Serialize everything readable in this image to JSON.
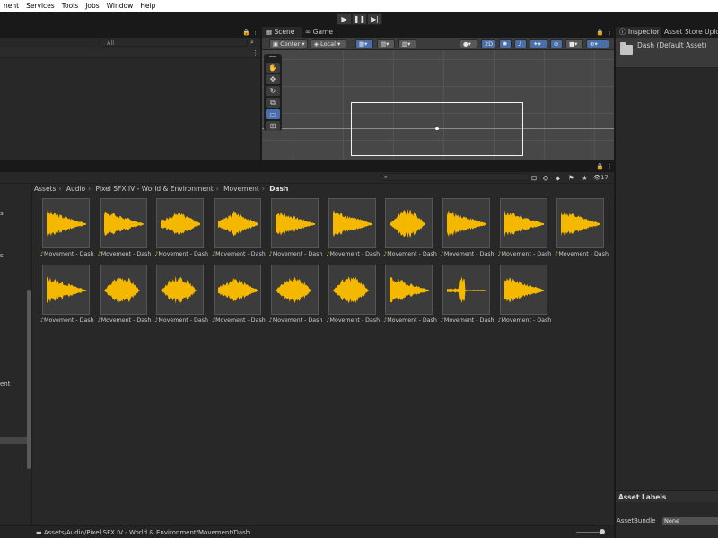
{
  "menu": [
    "nent",
    "Services",
    "Tools",
    "Jobs",
    "Window",
    "Help"
  ],
  "play_controls": {
    "play": "▶",
    "pause": "❚❚",
    "step": "▶|"
  },
  "hierarchy": {
    "search_placeholder": "All"
  },
  "scene": {
    "tab_scene": "Scene",
    "tab_game": "Game",
    "pivot": "Center",
    "space": "Local",
    "mode_2d": "2D"
  },
  "inspector": {
    "tab": "Inspector",
    "tab_store": "Asset Store Upload",
    "title": "Dash (Default Asset)",
    "labels_header": "Asset Labels",
    "assetbundle_label": "AssetBundle",
    "assetbundle_value": "None"
  },
  "project": {
    "hidden_count": "17",
    "breadcrumb": [
      "Assets",
      "Audio",
      "Pixel SFX IV - World & Environment",
      "Movement",
      "Dash"
    ],
    "status_path": "Assets/Audio/Pixel SFX IV - World & Environment/Movement/Dash",
    "left_items": [
      "s",
      "s",
      "ent"
    ],
    "assets": [
      "Movement - Dash",
      "Movement - Dash",
      "Movement - Dash",
      "Movement - Dash",
      "Movement - Dash",
      "Movement - Dash",
      "Movement - Dash",
      "Movement - Dash",
      "Movement - Dash",
      "Movement - Dash",
      "Movement - Dash",
      "Movement - Dash",
      "Movement - Dash",
      "Movement - Dash",
      "Movement - Dash",
      "Movement - Dash",
      "Movement - Dash",
      "Movement - Dash",
      "Movement - Dash"
    ]
  },
  "colors": {
    "waveform": "#f5b800",
    "accent": "#4a6ea8"
  }
}
